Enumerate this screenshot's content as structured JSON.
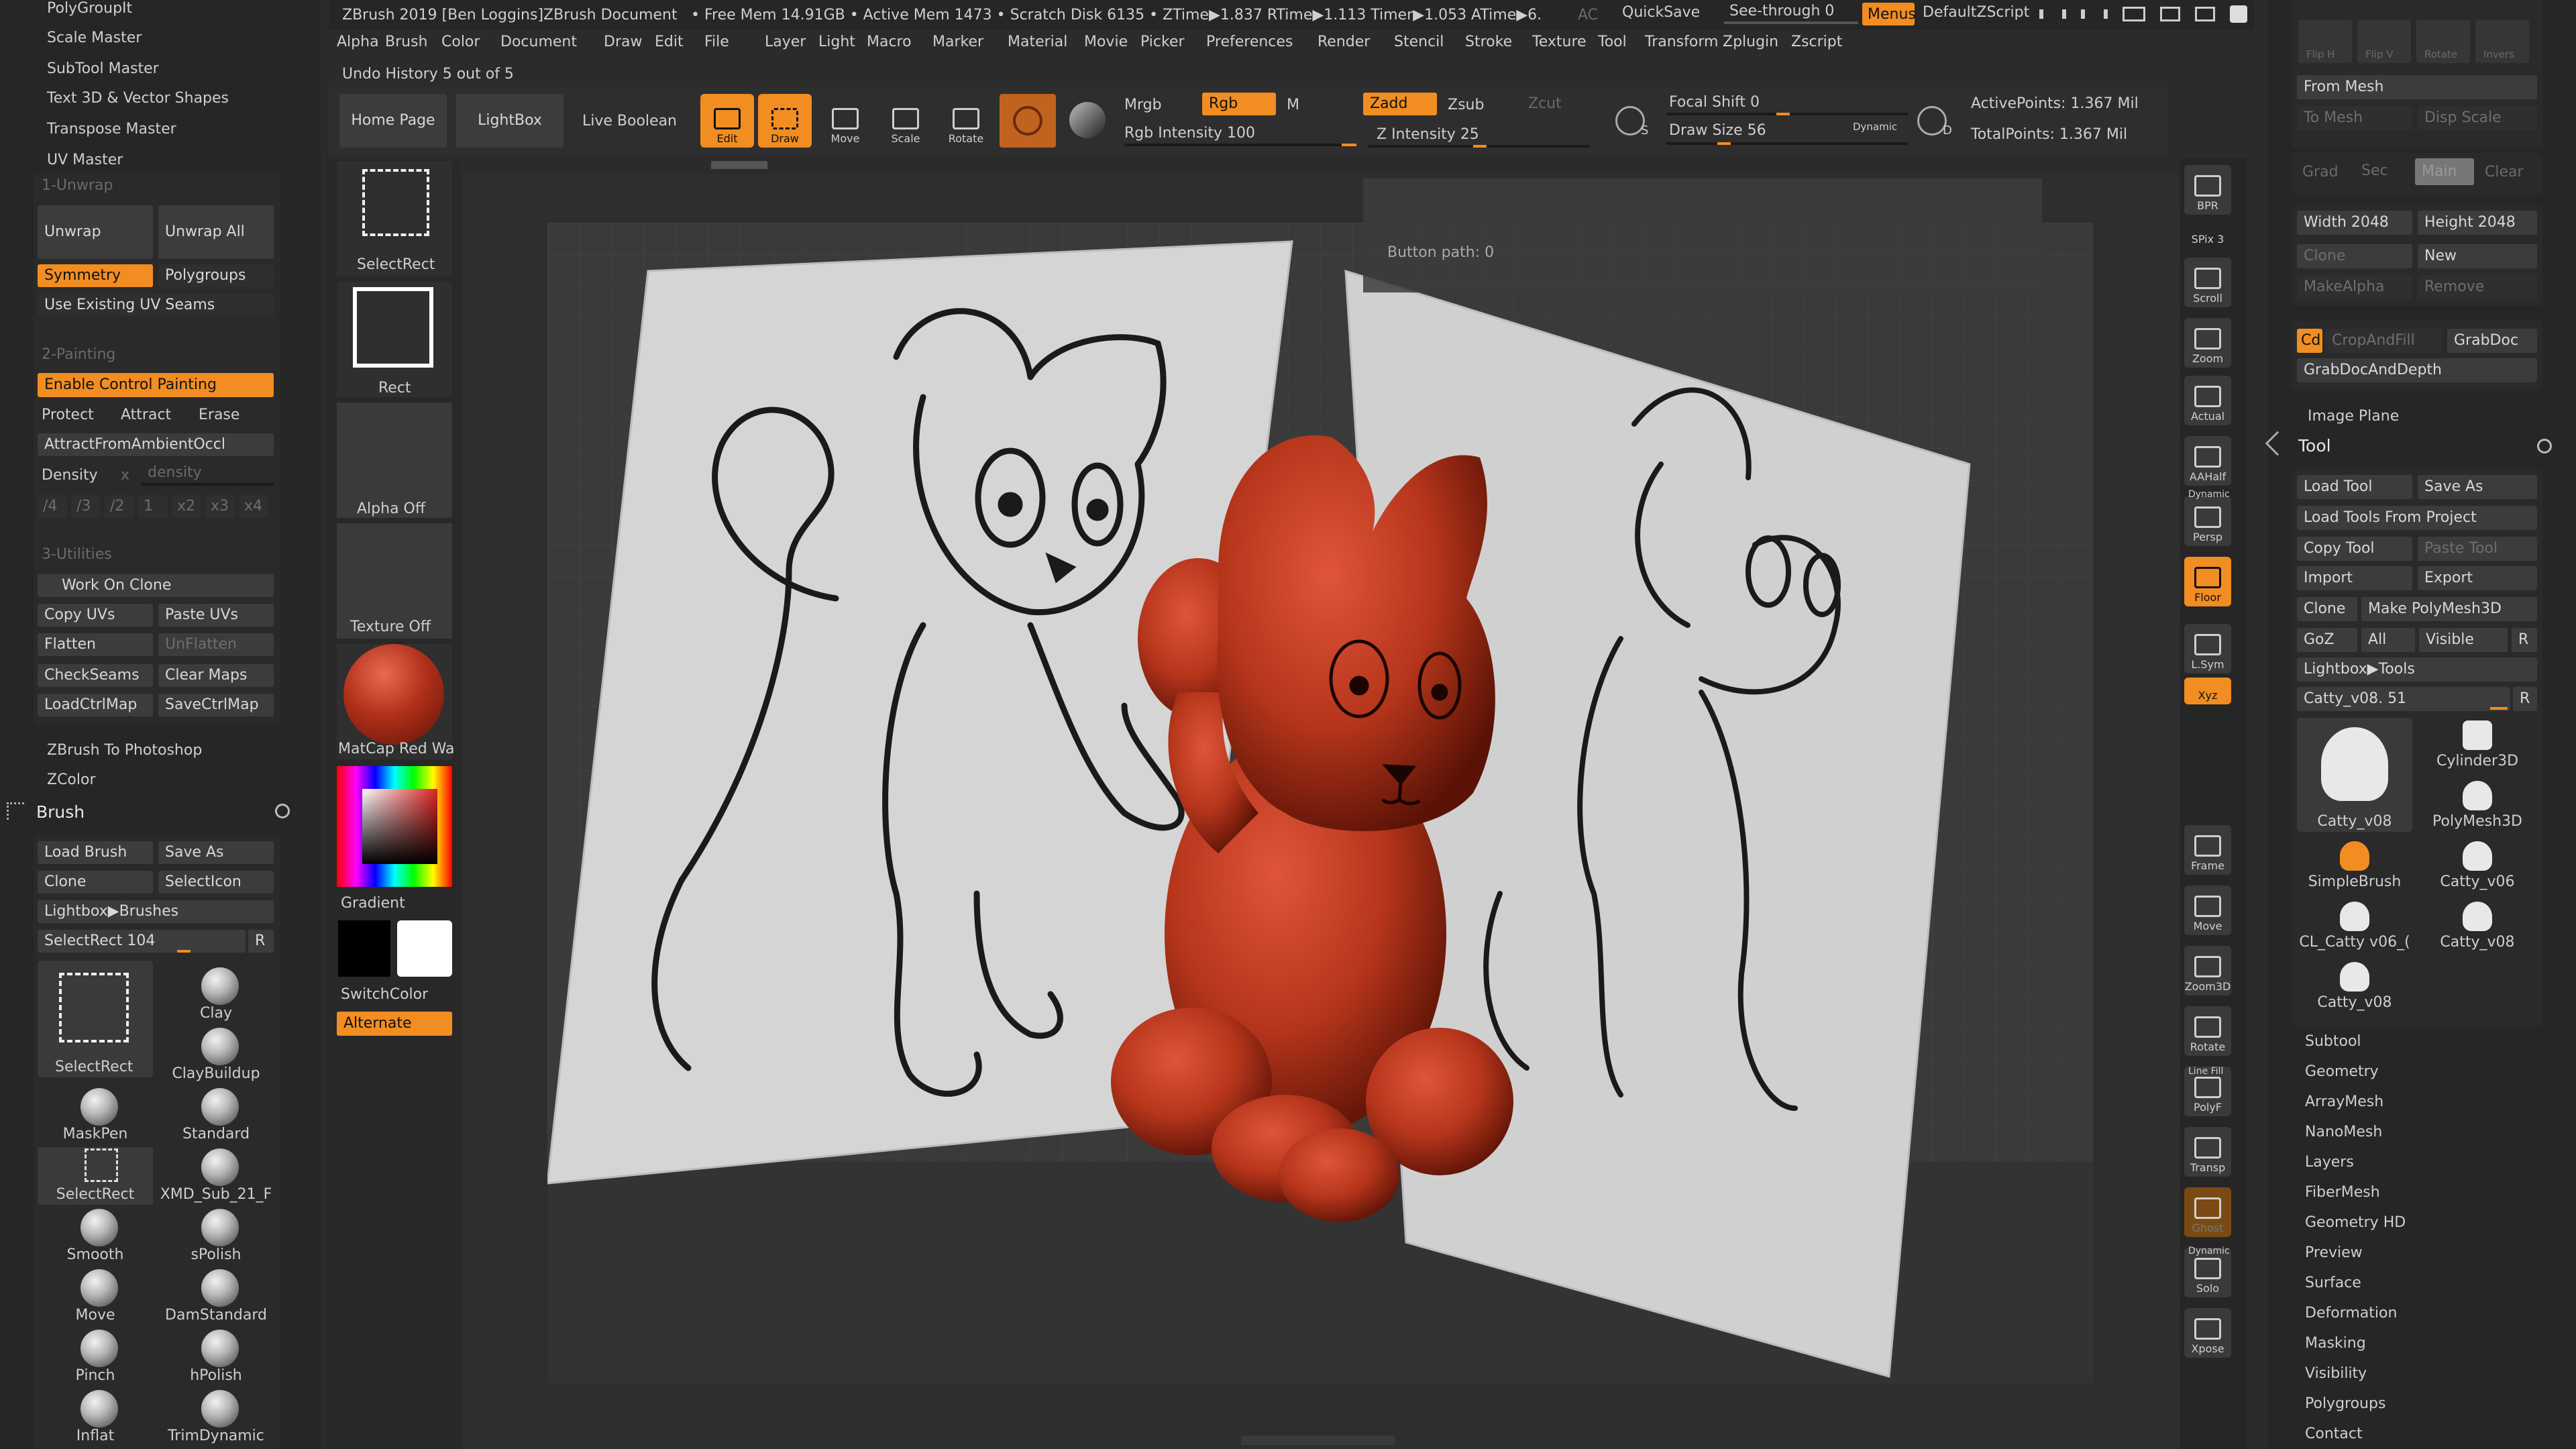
{
  "app": {
    "title": "ZBrush 2019 [Ben Loggins]ZBrush Document",
    "status": "• Free Mem 14.91GB • Active Mem 1473 • Scratch Disk 6135 • ZTime▶1.837 RTime▶1.113 Timer▶1.053 ATime▶6.",
    "ac": "AC",
    "quicksave": "QuickSave",
    "see_through": "See-through  0",
    "menus": "Menus",
    "default_zscript": "DefaultZScript",
    "undo_history": "Undo History 5 out of 5"
  },
  "menu": [
    "Alpha",
    "Brush",
    "Color",
    "Document",
    "Draw",
    "Edit",
    "File",
    "Layer",
    "Light",
    "Macro",
    "Marker",
    "Material",
    "Movie",
    "Picker",
    "Preferences",
    "Render",
    "Stencil",
    "Stroke",
    "Texture",
    "Tool",
    "Transform",
    "Zplugin",
    "Zscript"
  ],
  "toolbar": {
    "home_page": "Home Page",
    "lightbox": "LightBox",
    "live_boolean": "Live Boolean",
    "edit": "Edit",
    "draw": "Draw",
    "move": "Move",
    "scale": "Scale",
    "rotate": "Rotate",
    "mrgb": "Mrgb",
    "rgb": "Rgb",
    "m": "M",
    "rgb_intensity": "Rgb Intensity 100",
    "zadd": "Zadd",
    "zsub": "Zsub",
    "zcut": "Zcut",
    "z_intensity": "Z Intensity 25",
    "focal_shift": "Focal Shift 0",
    "draw_size": "Draw Size 56",
    "dynamic": "Dynamic",
    "active_points": "ActivePoints: 1.367 Mil",
    "total_points": "TotalPoints: 1.367 Mil",
    "s_label": "S",
    "d_label": "D",
    "button_path": "Button path: 0"
  },
  "left": {
    "top_items": [
      "PolyGroupIt",
      "Scale Master",
      "SubTool Master",
      "Text 3D & Vector Shapes",
      "Transpose Master",
      "UV Master"
    ],
    "unwrap_section": "1-Unwrap",
    "unwrap": "Unwrap",
    "unwrap_all": "Unwrap All",
    "symmetry": "Symmetry",
    "polygroups": "Polygroups",
    "use_existing": "Use Existing UV Seams",
    "painting_section": "2-Painting",
    "enable_control": "Enable Control Painting",
    "protect": "Protect",
    "attract": "Attract",
    "erase": "Erase",
    "attract_ambient": "AttractFromAmbientOccl",
    "density": "Density",
    "density_x": "x",
    "density_slider": "density",
    "density_opts": [
      "/4",
      "/3",
      "/2",
      "1",
      "x2",
      "x3",
      "x4"
    ],
    "utilities_section": "3-Utilities",
    "work_on_clone": "Work On Clone",
    "copy_uvs": "Copy UVs",
    "paste_uvs": "Paste UVs",
    "flatten": "Flatten",
    "unflatten": "UnFlatten",
    "checkseams": "CheckSeams",
    "clear_maps": "Clear Maps",
    "load_ctrl": "LoadCtrlMap",
    "save_ctrl": "SaveCtrlMap",
    "zbrush_to_ps": "ZBrush To Photoshop",
    "zcolor": "ZColor",
    "brush_title": "Brush",
    "load_brush": "Load Brush",
    "save_as": "Save As",
    "clone": "Clone",
    "select_icon": "SelectIcon",
    "lightbox_brushes": "Lightbox▶Brushes",
    "select_rect_slider": "SelectRect  104",
    "r": "R",
    "brushes": [
      "SelectRect",
      "Clay",
      "ClayBuildup",
      "MaskPen",
      "Standard",
      "SelectRect",
      "XMD_Sub_21_F",
      "Smooth",
      "sPolish",
      "Move",
      "DamStandard",
      "Pinch",
      "hPolish",
      "Inflat",
      "TrimDynamic"
    ]
  },
  "shelf": {
    "select_rect": "SelectRect",
    "rect": "Rect",
    "alpha_off": "Alpha Off",
    "texture_off": "Texture Off",
    "matcap": "MatCap Red Wa",
    "gradient": "Gradient",
    "switch_color": "SwitchColor",
    "alternate": "Alternate"
  },
  "right_tools": [
    "BPR",
    "SPix 3",
    "Scroll",
    "Zoom",
    "Actual",
    "AAHalf",
    "Persp",
    "Floor",
    "L.Sym",
    "Xyz",
    "Frame",
    "Move",
    "Zoom3D",
    "Rotate",
    "PolyF",
    "Transp",
    "Ghost",
    "Solo",
    "Xpose"
  ],
  "right_tool_extras": {
    "dynamic": "Dynamic",
    "line_fill": "Line Fill",
    "dynamic2": "Dynamic"
  },
  "right": {
    "flip_h": "Flip H",
    "flip_v": "Flip V",
    "rotate": "Rotate",
    "invers": "Invers",
    "from_mesh": "From Mesh",
    "to_mesh": "To Mesh",
    "disp_scale": "Disp Scale",
    "grad": "Grad",
    "sec": "Sec",
    "main": "Main",
    "clear": "Clear",
    "width": "Width 2048",
    "height": "Height 2048",
    "clone": "Clone",
    "new": "New",
    "make_alpha": "MakeAlpha",
    "remove": "Remove",
    "cd": "Cd",
    "crop_fill": "CropAndFill",
    "grabdoc": "GrabDoc",
    "grabdoc_depth": "GrabDocAndDepth",
    "image_plane": "Image Plane",
    "tool_title": "Tool",
    "load_tool": "Load Tool",
    "save_as": "Save As",
    "load_tools_project": "Load Tools From Project",
    "copy_tool": "Copy Tool",
    "paste_tool": "Paste Tool",
    "import": "Import",
    "export": "Export",
    "clone2": "Clone",
    "make_polymesh": "Make PolyMesh3D",
    "goz": "GoZ",
    "all": "All",
    "visible": "Visible",
    "r": "R",
    "lightbox_tools": "Lightbox▶Tools",
    "catty_slider": "Catty_v08. 51",
    "tools": [
      "Catty_v08",
      "Cylinder3D",
      "PolyMesh3D",
      "SimpleBrush",
      "Catty_v06",
      "CL_Catty v06_(",
      "Catty_v08",
      "Catty_v08"
    ],
    "sections": [
      "Subtool",
      "Geometry",
      "ArrayMesh",
      "NanoMesh",
      "Layers",
      "FiberMesh",
      "Geometry HD",
      "Preview",
      "Surface",
      "Deformation",
      "Masking",
      "Visibility",
      "Polygroups",
      "Contact"
    ]
  },
  "colors": {
    "accent": "#f18d21",
    "clay_red": "#b5351b",
    "bg": "#2b2b2b"
  }
}
